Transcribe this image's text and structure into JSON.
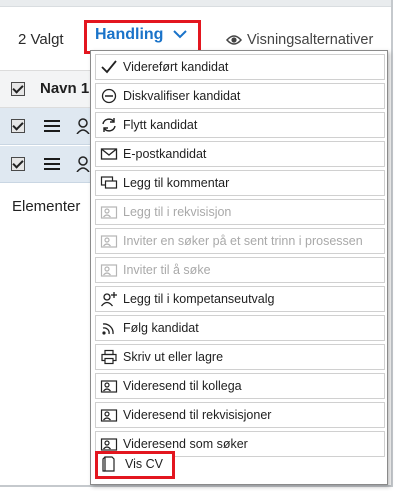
{
  "toolbar": {
    "selected_count": "2 Valgt",
    "action_label": "Handling",
    "view_options_label": "Visningsalternativer"
  },
  "table": {
    "header_label": "Navn 1"
  },
  "footer": {
    "text": "Elementer"
  },
  "menu": {
    "items": [
      {
        "label": "Videreført kandidat",
        "icon": "check-icon",
        "enabled": true
      },
      {
        "label": "Diskvalifiser kandidat",
        "icon": "minus-circle-icon",
        "enabled": true
      },
      {
        "label": "Flytt kandidat",
        "icon": "refresh-icon",
        "enabled": true
      },
      {
        "label": "E-postkandidat",
        "icon": "envelope-icon",
        "enabled": true
      },
      {
        "label": "Legg til kommentar",
        "icon": "comment-icon",
        "enabled": true
      },
      {
        "label": "Legg til i rekvisisjon",
        "icon": "person-card-icon",
        "enabled": false
      },
      {
        "label": "Inviter en søker på et sent trinn i prosessen",
        "icon": "person-card-icon",
        "enabled": false
      },
      {
        "label": "Inviter til å søke",
        "icon": "person-card-icon",
        "enabled": false
      },
      {
        "label": "Legg til i kompetanseutvalg",
        "icon": "person-add-icon",
        "enabled": true
      },
      {
        "label": "Følg kandidat",
        "icon": "rss-icon",
        "enabled": true
      },
      {
        "label": "Skriv ut eller lagre",
        "icon": "printer-icon",
        "enabled": true
      },
      {
        "label": "Videresend til kollega",
        "icon": "person-card-icon",
        "enabled": true
      },
      {
        "label": "Videresend til rekvisisjoner",
        "icon": "person-card-icon",
        "enabled": true
      },
      {
        "label": "Videresend som søker",
        "icon": "person-card-icon",
        "enabled": true
      },
      {
        "label": "Vis CV",
        "icon": "document-icon",
        "enabled": true,
        "highlighted": true
      }
    ]
  },
  "colors": {
    "accent": "#1a73c9",
    "highlight_border": "#e3161f",
    "selected_row": "#dfe8f1"
  }
}
